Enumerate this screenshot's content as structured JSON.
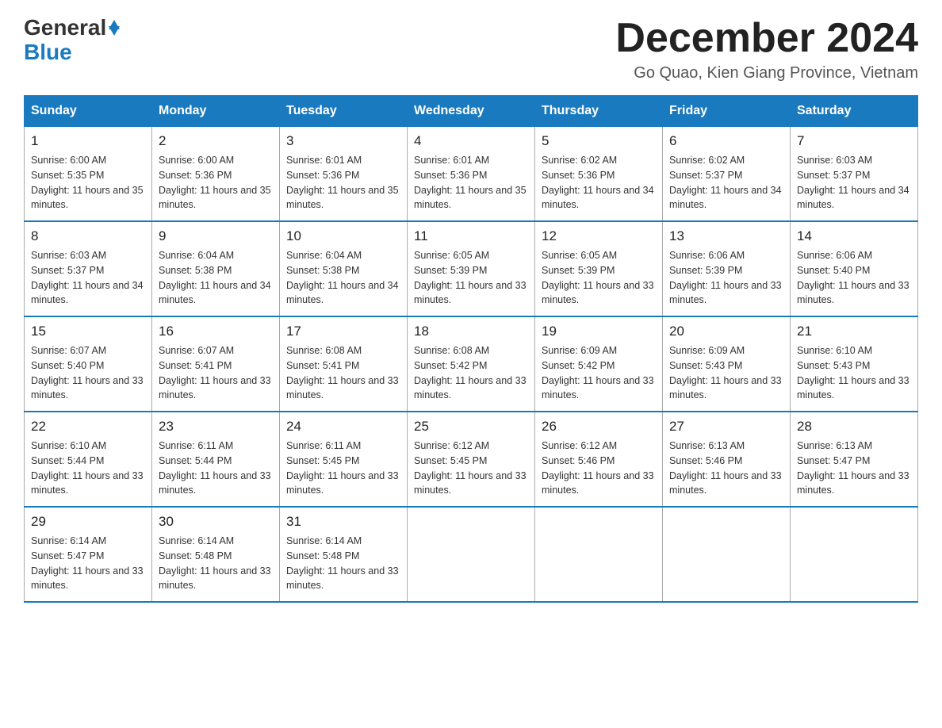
{
  "header": {
    "logo_general": "General",
    "logo_blue": "Blue",
    "month_title": "December 2024",
    "location": "Go Quao, Kien Giang Province, Vietnam"
  },
  "days_of_week": [
    "Sunday",
    "Monday",
    "Tuesday",
    "Wednesday",
    "Thursday",
    "Friday",
    "Saturday"
  ],
  "weeks": [
    [
      {
        "day": "1",
        "sunrise": "6:00 AM",
        "sunset": "5:35 PM",
        "daylight": "11 hours and 35 minutes."
      },
      {
        "day": "2",
        "sunrise": "6:00 AM",
        "sunset": "5:36 PM",
        "daylight": "11 hours and 35 minutes."
      },
      {
        "day": "3",
        "sunrise": "6:01 AM",
        "sunset": "5:36 PM",
        "daylight": "11 hours and 35 minutes."
      },
      {
        "day": "4",
        "sunrise": "6:01 AM",
        "sunset": "5:36 PM",
        "daylight": "11 hours and 35 minutes."
      },
      {
        "day": "5",
        "sunrise": "6:02 AM",
        "sunset": "5:36 PM",
        "daylight": "11 hours and 34 minutes."
      },
      {
        "day": "6",
        "sunrise": "6:02 AM",
        "sunset": "5:37 PM",
        "daylight": "11 hours and 34 minutes."
      },
      {
        "day": "7",
        "sunrise": "6:03 AM",
        "sunset": "5:37 PM",
        "daylight": "11 hours and 34 minutes."
      }
    ],
    [
      {
        "day": "8",
        "sunrise": "6:03 AM",
        "sunset": "5:37 PM",
        "daylight": "11 hours and 34 minutes."
      },
      {
        "day": "9",
        "sunrise": "6:04 AM",
        "sunset": "5:38 PM",
        "daylight": "11 hours and 34 minutes."
      },
      {
        "day": "10",
        "sunrise": "6:04 AM",
        "sunset": "5:38 PM",
        "daylight": "11 hours and 34 minutes."
      },
      {
        "day": "11",
        "sunrise": "6:05 AM",
        "sunset": "5:39 PM",
        "daylight": "11 hours and 33 minutes."
      },
      {
        "day": "12",
        "sunrise": "6:05 AM",
        "sunset": "5:39 PM",
        "daylight": "11 hours and 33 minutes."
      },
      {
        "day": "13",
        "sunrise": "6:06 AM",
        "sunset": "5:39 PM",
        "daylight": "11 hours and 33 minutes."
      },
      {
        "day": "14",
        "sunrise": "6:06 AM",
        "sunset": "5:40 PM",
        "daylight": "11 hours and 33 minutes."
      }
    ],
    [
      {
        "day": "15",
        "sunrise": "6:07 AM",
        "sunset": "5:40 PM",
        "daylight": "11 hours and 33 minutes."
      },
      {
        "day": "16",
        "sunrise": "6:07 AM",
        "sunset": "5:41 PM",
        "daylight": "11 hours and 33 minutes."
      },
      {
        "day": "17",
        "sunrise": "6:08 AM",
        "sunset": "5:41 PM",
        "daylight": "11 hours and 33 minutes."
      },
      {
        "day": "18",
        "sunrise": "6:08 AM",
        "sunset": "5:42 PM",
        "daylight": "11 hours and 33 minutes."
      },
      {
        "day": "19",
        "sunrise": "6:09 AM",
        "sunset": "5:42 PM",
        "daylight": "11 hours and 33 minutes."
      },
      {
        "day": "20",
        "sunrise": "6:09 AM",
        "sunset": "5:43 PM",
        "daylight": "11 hours and 33 minutes."
      },
      {
        "day": "21",
        "sunrise": "6:10 AM",
        "sunset": "5:43 PM",
        "daylight": "11 hours and 33 minutes."
      }
    ],
    [
      {
        "day": "22",
        "sunrise": "6:10 AM",
        "sunset": "5:44 PM",
        "daylight": "11 hours and 33 minutes."
      },
      {
        "day": "23",
        "sunrise": "6:11 AM",
        "sunset": "5:44 PM",
        "daylight": "11 hours and 33 minutes."
      },
      {
        "day": "24",
        "sunrise": "6:11 AM",
        "sunset": "5:45 PM",
        "daylight": "11 hours and 33 minutes."
      },
      {
        "day": "25",
        "sunrise": "6:12 AM",
        "sunset": "5:45 PM",
        "daylight": "11 hours and 33 minutes."
      },
      {
        "day": "26",
        "sunrise": "6:12 AM",
        "sunset": "5:46 PM",
        "daylight": "11 hours and 33 minutes."
      },
      {
        "day": "27",
        "sunrise": "6:13 AM",
        "sunset": "5:46 PM",
        "daylight": "11 hours and 33 minutes."
      },
      {
        "day": "28",
        "sunrise": "6:13 AM",
        "sunset": "5:47 PM",
        "daylight": "11 hours and 33 minutes."
      }
    ],
    [
      {
        "day": "29",
        "sunrise": "6:14 AM",
        "sunset": "5:47 PM",
        "daylight": "11 hours and 33 minutes."
      },
      {
        "day": "30",
        "sunrise": "6:14 AM",
        "sunset": "5:48 PM",
        "daylight": "11 hours and 33 minutes."
      },
      {
        "day": "31",
        "sunrise": "6:14 AM",
        "sunset": "5:48 PM",
        "daylight": "11 hours and 33 minutes."
      },
      null,
      null,
      null,
      null
    ]
  ]
}
